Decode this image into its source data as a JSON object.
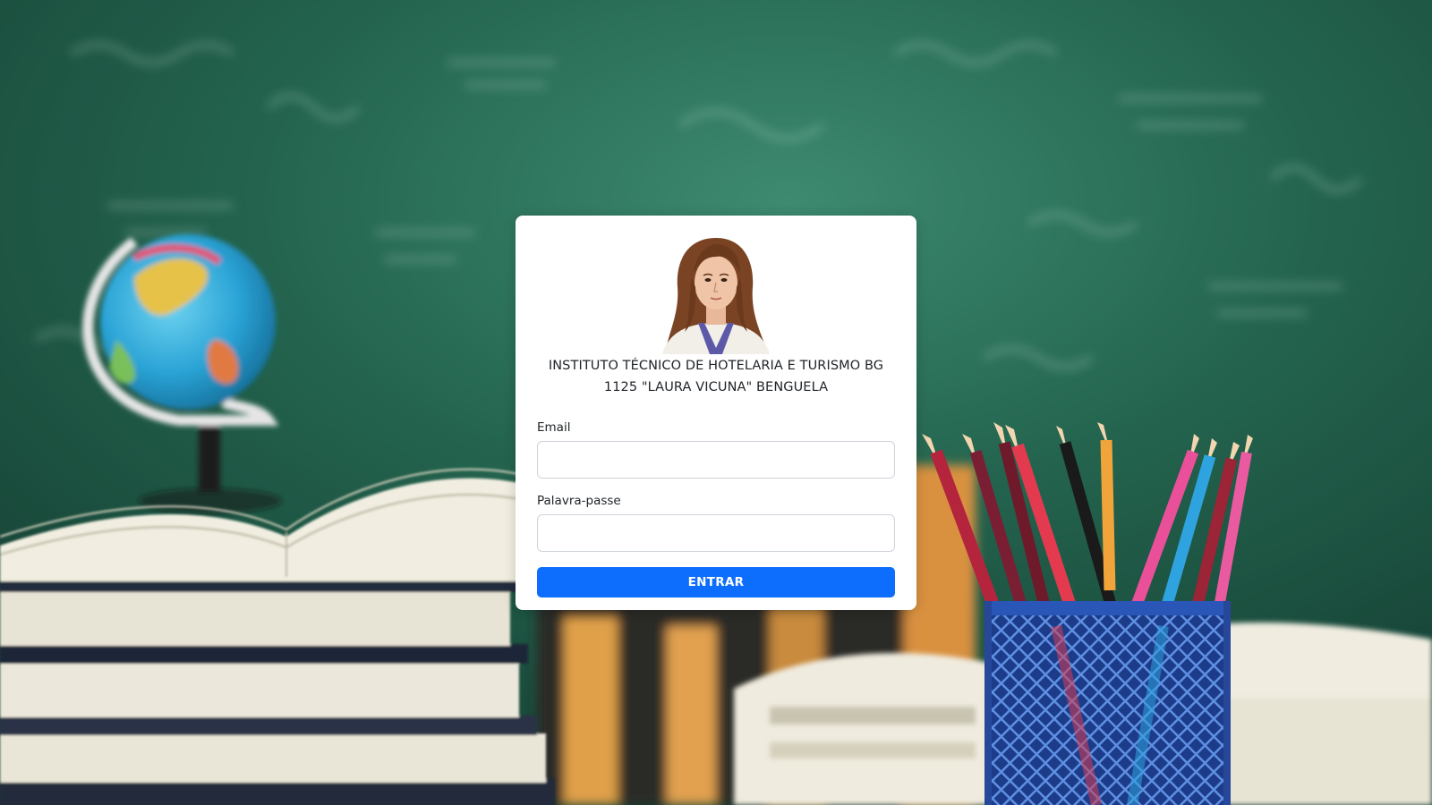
{
  "login_card": {
    "school_name_line1": "INSTITUTO TÉCNICO DE HOTELARIA E TURISMO BG",
    "school_name_line2": "1125 \"LAURA VICUNA\" BENGUELA",
    "email_label": "Email",
    "email_value": "",
    "password_label": "Palavra-passe",
    "password_value": "",
    "submit_label": "ENTRAR"
  },
  "colors": {
    "primary_button": "#0d6efd",
    "chalkboard": "#1f5a45"
  },
  "icons": {
    "logo": "school-patron-portrait-logo"
  }
}
